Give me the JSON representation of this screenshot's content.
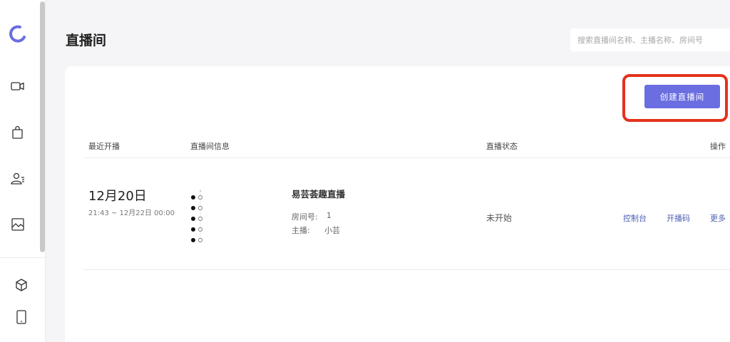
{
  "page": {
    "title": "直播间"
  },
  "search": {
    "placeholder": "搜索直播间名称、主播名称、房间号"
  },
  "toolbar": {
    "create_label": "创建直播间"
  },
  "table": {
    "headers": {
      "recent": "最近开播",
      "info": "直播间信息",
      "status": "直播状态",
      "actions": "操作"
    },
    "rows": [
      {
        "date_main": "12月20日",
        "date_range": "21:43 ~ 12月22日 00:00",
        "name": "易芸荟趣直播",
        "room_label": "房间号:",
        "room_value": "1",
        "host_label": "主播:",
        "host_value": "小芸",
        "status": "未开始",
        "actions": {
          "console": "控制台",
          "stream_code": "开播码",
          "more": "更多"
        }
      }
    ]
  },
  "colors": {
    "accent": "#6a6ee0",
    "highlight": "#e4321b",
    "link": "#4b5fb3"
  },
  "icons": {
    "sidebar": [
      "logo-icon",
      "video-icon",
      "shopping-bag-icon",
      "user-list-icon",
      "image-chart-icon",
      "cube-icon",
      "tablet-icon"
    ]
  }
}
